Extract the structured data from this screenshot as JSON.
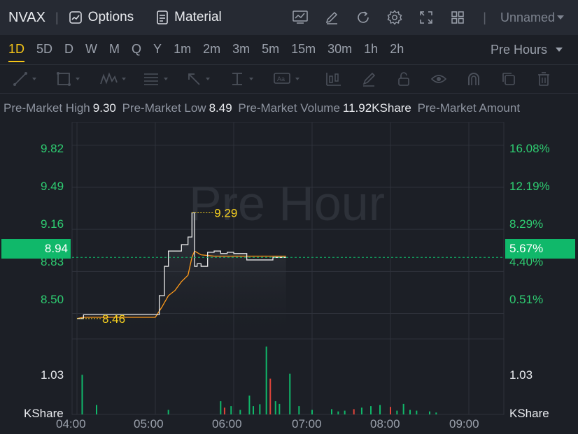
{
  "toolbar": {
    "symbol": "NVAX",
    "options_label": "Options",
    "material_label": "Material",
    "layout_name": "Unnamed"
  },
  "periods": [
    "1D",
    "5D",
    "D",
    "W",
    "M",
    "Q",
    "Y",
    "1m",
    "2m",
    "3m",
    "5m",
    "15m",
    "30m",
    "1h",
    "2h"
  ],
  "active_period": "1D",
  "session_select": "Pre Hours",
  "stats": [
    {
      "label": "Pre-Market High",
      "value": "9.30"
    },
    {
      "label": "Pre-Market Low",
      "value": "8.49"
    },
    {
      "label": "Pre-Market Volume",
      "value": "11.92KShare"
    },
    {
      "label": "Pre-Market Amount",
      "value": ""
    }
  ],
  "colors": {
    "up": "#10b86a",
    "down": "#e0443a",
    "price_line": "#e8e8e8",
    "avg_line": "#ff9a1a",
    "marker": "#f5d020"
  },
  "chart_data": {
    "type": "line",
    "watermark": "Pre Hour",
    "y_left_ticks": [
      "9.82",
      "9.49",
      "9.16",
      "8.83",
      "8.50"
    ],
    "y_right_ticks": [
      "16.08%",
      "12.19%",
      "8.29%",
      "4.40%",
      "0.51%"
    ],
    "current_price": "8.94",
    "current_change": "5.67%",
    "ylim": [
      8.3,
      10.0
    ],
    "volume_axis_tick": "1.03",
    "volume_unit": "KShare",
    "x_ticks": [
      "04:00",
      "05:00",
      "06:00",
      "07:00",
      "08:00",
      "09:00"
    ],
    "high_marker": "9.29",
    "low_marker": "8.46",
    "series": [
      {
        "name": "Price",
        "x": [
          "04:00",
          "04:05",
          "04:10",
          "04:20",
          "04:35",
          "04:50",
          "05:00",
          "05:03",
          "05:07",
          "05:10",
          "05:15",
          "05:20",
          "05:25",
          "05:28",
          "05:30",
          "05:32",
          "05:35",
          "05:40",
          "05:45",
          "05:50",
          "05:55",
          "06:00",
          "06:05",
          "06:10",
          "06:15",
          "06:20",
          "06:25",
          "06:30",
          "06:35",
          "06:40"
        ],
        "values": [
          8.46,
          8.49,
          8.49,
          8.49,
          8.49,
          8.49,
          8.49,
          8.64,
          8.87,
          8.99,
          8.99,
          9.04,
          9.1,
          9.29,
          8.87,
          8.89,
          8.87,
          8.98,
          8.99,
          8.97,
          8.98,
          8.97,
          8.97,
          8.92,
          8.92,
          8.92,
          8.92,
          8.94,
          8.94,
          8.94
        ]
      },
      {
        "name": "Average",
        "x": [
          "04:00",
          "04:05",
          "04:10",
          "04:20",
          "04:35",
          "04:50",
          "05:00",
          "05:05",
          "05:10",
          "05:15",
          "05:20",
          "05:25",
          "05:28",
          "05:30",
          "05:35",
          "05:45",
          "05:55",
          "06:05",
          "06:20",
          "06:40"
        ],
        "values": [
          8.46,
          8.47,
          8.47,
          8.47,
          8.47,
          8.47,
          8.47,
          8.55,
          8.64,
          8.68,
          8.75,
          8.8,
          8.94,
          8.99,
          8.96,
          8.95,
          8.95,
          8.95,
          8.95,
          8.95
        ]
      }
    ],
    "volume": {
      "x_minutes": [
        4,
        15,
        70,
        110,
        113,
        118,
        125,
        132,
        135,
        140,
        145,
        148,
        152,
        155,
        163,
        170,
        180,
        195,
        200,
        205,
        212,
        218,
        225,
        232,
        240,
        245,
        250,
        255,
        260,
        270,
        275
      ],
      "values": [
        1.05,
        0.25,
        0.12,
        0.35,
        0.18,
        0.22,
        0.12,
        0.5,
        0.22,
        0.27,
        1.8,
        0.95,
        0.35,
        0.28,
        1.08,
        0.22,
        0.12,
        0.14,
        0.08,
        0.1,
        0.14,
        0.18,
        0.22,
        0.25,
        0.2,
        0.1,
        0.28,
        0.12,
        0.1,
        0.08,
        0.05
      ],
      "direction": [
        "up",
        "up",
        "up",
        "up",
        "down",
        "up",
        "up",
        "up",
        "up",
        "up",
        "up",
        "down",
        "up",
        "up",
        "up",
        "up",
        "up",
        "up",
        "up",
        "up",
        "down",
        "up",
        "up",
        "up",
        "down",
        "up",
        "up",
        "up",
        "up",
        "up",
        "up"
      ]
    }
  }
}
